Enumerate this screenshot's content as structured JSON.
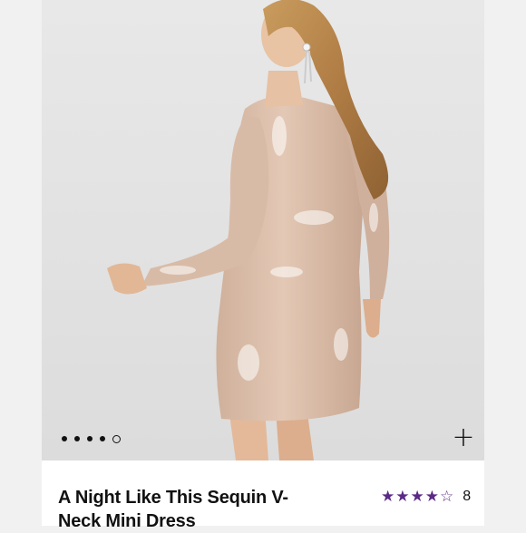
{
  "product": {
    "title": "A Night Like This Sequin V-Neck Mini Dress",
    "rating": {
      "stars_filled": 4,
      "stars_total": 5,
      "review_count": "8"
    }
  },
  "gallery": {
    "image_count": 5,
    "active_index": 4
  },
  "icons": {
    "expand": "plus-icon",
    "star_filled": "star-icon",
    "star_empty": "star-outline-icon"
  },
  "colors": {
    "star": "#5b2a86",
    "dress": "#d9bda9",
    "hair": "#b7894f",
    "skin": "#e6c1a3"
  }
}
